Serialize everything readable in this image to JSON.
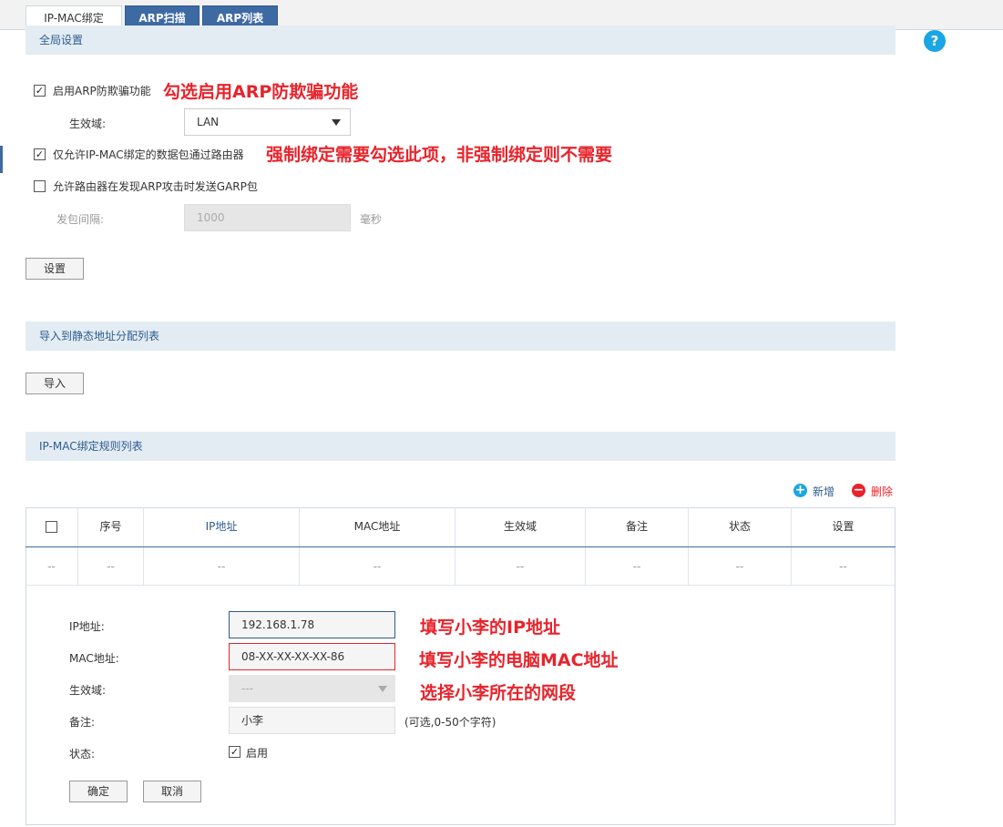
{
  "tabs": [
    {
      "label": "IP-MAC绑定"
    },
    {
      "label": "ARP扫描"
    },
    {
      "label": "ARP列表"
    }
  ],
  "help_glyph": "?",
  "global": {
    "title": "全局设置",
    "arp_spoof_label": "启用ARP防欺骗功能",
    "arp_spoof_checked": true,
    "arp_spoof_anno": "勾选启用ARP防欺骗功能",
    "scope_label": "生效域:",
    "scope_value": "LAN",
    "only_bound_label": "仅允许IP-MAC绑定的数据包通过路由器",
    "only_bound_checked": true,
    "only_bound_anno": "强制绑定需要勾选此项，非强制绑定则不需要",
    "garp_label": "允许路由器在发现ARP攻击时发送GARP包",
    "garp_checked": false,
    "interval_label": "发包间隔:",
    "interval_value": "1000",
    "interval_unit": "毫秒",
    "set_button": "设置"
  },
  "import_section": {
    "title": "导入到静态地址分配列表",
    "import_button": "导入"
  },
  "rules": {
    "title": "IP-MAC绑定规则列表",
    "add_label": "新增",
    "delete_label": "删除",
    "columns": [
      "序号",
      "IP地址",
      "MAC地址",
      "生效域",
      "备注",
      "状态",
      "设置"
    ],
    "empty_row": [
      "--",
      "--",
      "--",
      "--",
      "--",
      "--",
      "--",
      "--"
    ]
  },
  "form": {
    "ip_label": "IP地址:",
    "ip_value": "192.168.1.78",
    "ip_anno": "填写小李的IP地址",
    "mac_label": "MAC地址:",
    "mac_value": "08-XX-XX-XX-XX-86",
    "mac_anno": "填写小李的电脑MAC地址",
    "scope_label": "生效域:",
    "scope_value": "---",
    "scope_anno": "选择小李所在的网段",
    "note_label": "备注:",
    "note_value": "小李",
    "note_hint": "(可选,0-50个字符)",
    "status_label": "状态:",
    "status_option": "启用",
    "status_checked": true,
    "ok_button": "确定",
    "cancel_button": "取消"
  },
  "colors": {
    "accent": "#3e6aa3",
    "annotation": "#e8232b",
    "section_bg": "#e4ecf3",
    "help": "#1aa6e4"
  }
}
